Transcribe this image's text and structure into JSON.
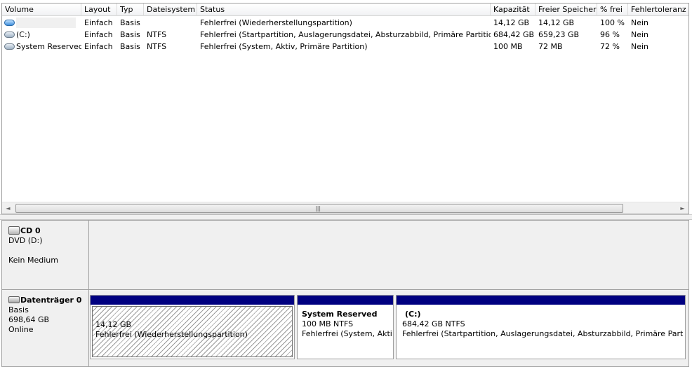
{
  "list": {
    "columns": [
      "Volume",
      "Layout",
      "Typ",
      "Dateisystem",
      "Status",
      "Kapazität",
      "Freier Speicher",
      "% frei",
      "Fehlertoleranz"
    ],
    "rows": [
      {
        "icon": "volume-blue-icon",
        "volume": "",
        "layout": "Einfach",
        "typ": "Basis",
        "fs": "",
        "status": "Fehlerfrei (Wiederherstellungspartition)",
        "kapazitaet": "14,12 GB",
        "frei": "14,12 GB",
        "prozent": "100 %",
        "fehlertoleranz": "Nein"
      },
      {
        "icon": "volume-gray-icon",
        "volume": "(C:)",
        "layout": "Einfach",
        "typ": "Basis",
        "fs": "NTFS",
        "status": "Fehlerfrei (Startpartition, Auslagerungsdatei, Absturzabbild, Primäre Partition)",
        "kapazitaet": "684,42 GB",
        "frei": "659,23 GB",
        "prozent": "96 %",
        "fehlertoleranz": "Nein"
      },
      {
        "icon": "volume-gray-icon",
        "volume": "System Reserved",
        "layout": "Einfach",
        "typ": "Basis",
        "fs": "NTFS",
        "status": "Fehlerfrei (System, Aktiv, Primäre Partition)",
        "kapazitaet": "100 MB",
        "frei": "72 MB",
        "prozent": "72 %",
        "fehlertoleranz": "Nein"
      }
    ],
    "scrollbar": {
      "left_arrow": "◄",
      "right_arrow": "►",
      "grip": "|||"
    }
  },
  "disks": {
    "cd": {
      "title": "CD 0",
      "type": "DVD (D:)",
      "state": "Kein Medium"
    },
    "disk0": {
      "title": "Datenträger 0",
      "type": "Basis",
      "size": "698,64 GB",
      "state": "Online",
      "partitions": [
        {
          "name": "",
          "size": "14,12 GB",
          "status": "Fehlerfrei (Wiederherstellungspartition)"
        },
        {
          "name": "System Reserved",
          "size": "100 MB NTFS",
          "status": "Fehlerfrei (System, Aktiv, Primäre Partition)"
        },
        {
          "name": "(C:)",
          "size": "684,42 GB NTFS",
          "status": "Fehlerfrei (Startpartition, Auslagerungsdatei, Absturzabbild, Primäre Partition)"
        }
      ]
    }
  },
  "colors": {
    "partition_bar": "#000080",
    "panel": "#f0f0f0"
  }
}
